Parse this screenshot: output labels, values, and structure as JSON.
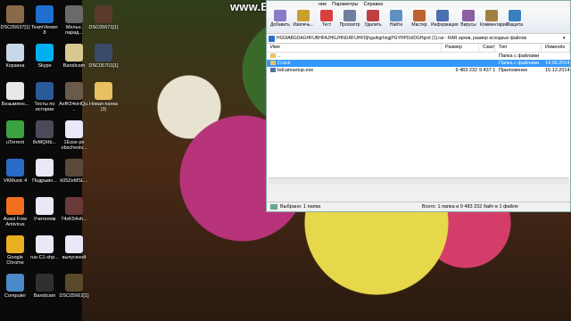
{
  "watermark": "www.Bandicam.com",
  "desktop_icons": [
    {
      "label": "DSC05637[1]",
      "color": "#8a6a4a"
    },
    {
      "label": "TeamViewer 8",
      "color": "#1e6fd0"
    },
    {
      "label": "Мельн. парад...",
      "color": "#6a6a6a"
    },
    {
      "label": "DSC05671[1]",
      "color": "#5a3a2a"
    },
    {
      "label": "Корзина",
      "color": "#c8d8e8"
    },
    {
      "label": "Skype",
      "color": "#00aff0"
    },
    {
      "label": "Bandicam",
      "color": "#d8c890"
    },
    {
      "label": "DSC05701[1]",
      "color": "#3a4a6a"
    },
    {
      "label": "Безымянн...",
      "color": "#e8e8e8"
    },
    {
      "label": "Тесты по истории",
      "color": "#2a5a9a"
    },
    {
      "label": "AxfK54oHQu...",
      "color": "#6a5a4a"
    },
    {
      "label": "Новая папка (3)",
      "color": "#e8c060"
    },
    {
      "label": "uTorrent",
      "color": "#3aa040"
    },
    {
      "label": "8vMQHb...",
      "color": "#4a4a5a"
    },
    {
      "label": "1Esse po obschestv...",
      "color": "#e8e8f8"
    },
    {
      "label": "",
      "color": "transparent"
    },
    {
      "label": "VKMusic 4",
      "color": "#2a6ac8"
    },
    {
      "label": "Подрывн...",
      "color": "#e8e8f8"
    },
    {
      "label": "k05ZeMSL...",
      "color": "#5a4a3a"
    },
    {
      "label": "",
      "color": "transparent"
    },
    {
      "label": "Avast Free Antivirus",
      "color": "#f07020"
    },
    {
      "label": "Учителям",
      "color": "#e8e8f8"
    },
    {
      "label": "74xK54oh...",
      "color": "#6a3a3a"
    },
    {
      "label": "",
      "color": "transparent"
    },
    {
      "label": "Google Chrome",
      "color": "#e8b020"
    },
    {
      "label": "rus-C1-shp...",
      "color": "#e8e8f8"
    },
    {
      "label": "выпускной",
      "color": "#e8e8f8"
    },
    {
      "label": "",
      "color": "transparent"
    },
    {
      "label": "Computer",
      "color": "#4a8ac8"
    },
    {
      "label": "Bandicam",
      "color": "#303030"
    },
    {
      "label": "DSC05662[1]",
      "color": "#5a4a2a"
    },
    {
      "label": "",
      "color": "transparent"
    }
  ],
  "winrar": {
    "menu": [
      "ние",
      "Параметры",
      "Справка"
    ],
    "toolbar": [
      {
        "label": "Добавить",
        "color": "#8a7ac8"
      },
      {
        "label": "Извлечь...",
        "color": "#c8a030"
      },
      {
        "label": "Тест",
        "color": "#d84040"
      },
      {
        "label": "Просмотр",
        "color": "#7080a0"
      },
      {
        "label": "Удалить",
        "color": "#c04040"
      },
      {
        "label": "Найти",
        "color": "#6090c0"
      },
      {
        "label": "Мастер",
        "color": "#c06030"
      },
      {
        "label": "Информация",
        "color": "#4a70b0"
      },
      {
        "label": "Вирусы",
        "color": "#8a60a0"
      },
      {
        "label": "Комментарий",
        "color": "#a08040"
      },
      {
        "label": "Защита",
        "color": "#3a80c0"
      }
    ],
    "path": "HSGfABGDAGHFUBHFAJHGJHNGRFUHFDjhguihgrhngjPGYHPDolDGHgvd (1).rar - RAR архив, размер исходных файлов",
    "columns": [
      "Имя",
      "Размер",
      "Сжат",
      "Тип",
      "Изменён"
    ],
    "rows": [
      {
        "name": "..",
        "size": "",
        "packed": "",
        "type": "Папка с файлами",
        "modified": "",
        "icon": "#e8c060",
        "selected": false
      },
      {
        "name": "Crack",
        "size": "",
        "packed": "",
        "type": "Папка с файлами",
        "modified": "14.06.2014",
        "icon": "#e8c060",
        "selected": true
      },
      {
        "name": "bdcamsetup.exe",
        "size": "9 483 232",
        "packed": "9 437 113",
        "type": "Приложение",
        "modified": "15.12.2014",
        "icon": "#5070a0",
        "selected": false
      }
    ],
    "status_left": "Выбрано: 1 папка",
    "status_right": "Всего: 1 папка и 9 483 232 байт в 1 файле"
  }
}
